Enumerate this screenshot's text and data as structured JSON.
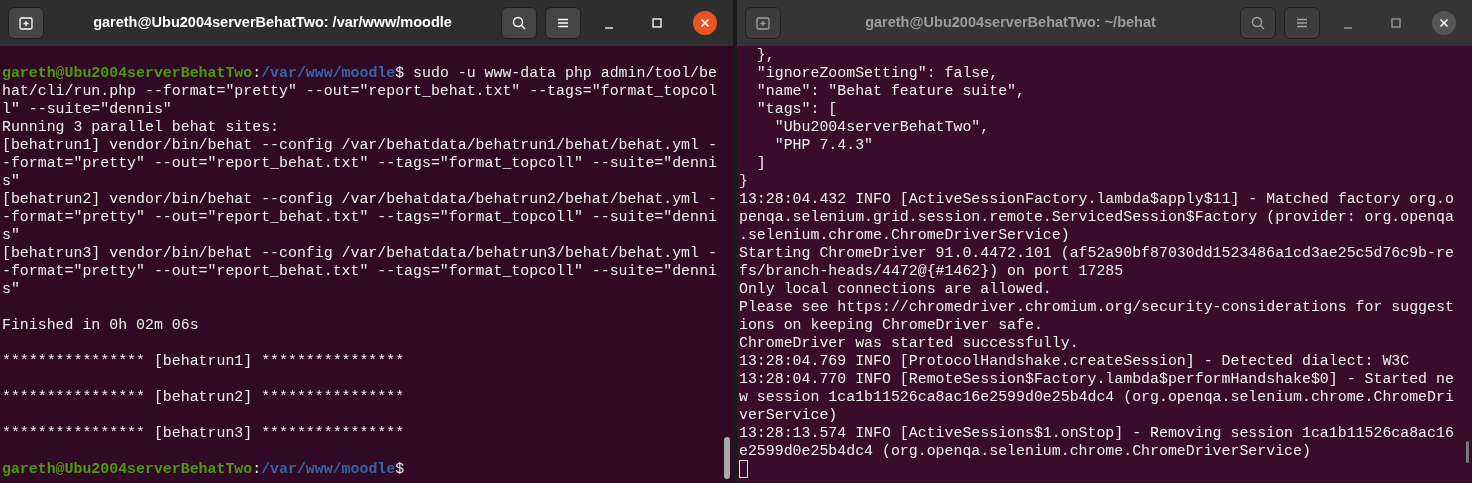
{
  "windows": [
    {
      "title": "gareth@Ubu2004serverBehatTwo: /var/www/moodle",
      "focused": true,
      "lines": [
        {
          "kind": "blank"
        },
        {
          "kind": "prompt",
          "segments": [
            {
              "kind": "user",
              "text": "gareth@Ubu2004serverBehatTwo"
            },
            {
              "kind": "plain",
              "text": ":"
            },
            {
              "kind": "path",
              "text": "/var/www/moodle"
            },
            {
              "kind": "plain",
              "text": "$ sudo -u www-data php admin/tool/be"
            }
          ]
        },
        {
          "kind": "text",
          "text": "hat/cli/run.php --format=\"pretty\" --out=\"report_behat.txt\" --tags=\"format_topcol"
        },
        {
          "kind": "text",
          "text": "l\" --suite=\"dennis\""
        },
        {
          "kind": "text",
          "text": "Running 3 parallel behat sites:"
        },
        {
          "kind": "text",
          "text": "[behatrun1] vendor/bin/behat --config /var/behatdata/behatrun1/behat/behat.yml -"
        },
        {
          "kind": "text",
          "text": "-format=\"pretty\" --out=\"report_behat.txt\" --tags=\"format_topcoll\" --suite=\"denni"
        },
        {
          "kind": "text",
          "text": "s\""
        },
        {
          "kind": "text",
          "text": "[behatrun2] vendor/bin/behat --config /var/behatdata/behatrun2/behat/behat.yml -"
        },
        {
          "kind": "text",
          "text": "-format=\"pretty\" --out=\"report_behat.txt\" --tags=\"format_topcoll\" --suite=\"denni"
        },
        {
          "kind": "text",
          "text": "s\""
        },
        {
          "kind": "text",
          "text": "[behatrun3] vendor/bin/behat --config /var/behatdata/behatrun3/behat/behat.yml -"
        },
        {
          "kind": "text",
          "text": "-format=\"pretty\" --out=\"report_behat.txt\" --tags=\"format_topcoll\" --suite=\"denni"
        },
        {
          "kind": "text",
          "text": "s\""
        },
        {
          "kind": "blank"
        },
        {
          "kind": "text",
          "text": "Finished in 0h 02m 06s"
        },
        {
          "kind": "blank"
        },
        {
          "kind": "text",
          "text": "**************** [behatrun1] ****************"
        },
        {
          "kind": "blank"
        },
        {
          "kind": "text",
          "text": "**************** [behatrun2] ****************"
        },
        {
          "kind": "blank"
        },
        {
          "kind": "text",
          "text": "**************** [behatrun3] ****************"
        },
        {
          "kind": "blank"
        },
        {
          "kind": "prompt",
          "segments": [
            {
              "kind": "user",
              "text": "gareth@Ubu2004serverBehatTwo"
            },
            {
              "kind": "plain",
              "text": ":"
            },
            {
              "kind": "path",
              "text": "/var/www/moodle"
            },
            {
              "kind": "plain",
              "text": "$"
            }
          ]
        }
      ]
    },
    {
      "title": "gareth@Ubu2004serverBehatTwo: ~/behat",
      "focused": false,
      "lines": [
        {
          "kind": "text",
          "text": "  },"
        },
        {
          "kind": "text",
          "text": "  \"ignoreZoomSetting\": false,"
        },
        {
          "kind": "text",
          "text": "  \"name\": \"Behat feature suite\","
        },
        {
          "kind": "text",
          "text": "  \"tags\": ["
        },
        {
          "kind": "text",
          "text": "    \"Ubu2004serverBehatTwo\","
        },
        {
          "kind": "text",
          "text": "    \"PHP 7.4.3\""
        },
        {
          "kind": "text",
          "text": "  ]"
        },
        {
          "kind": "text",
          "text": "}"
        },
        {
          "kind": "text",
          "text": "13:28:04.432 INFO [ActiveSessionFactory.lambda$apply$11] - Matched factory org.o"
        },
        {
          "kind": "text",
          "text": "penqa.selenium.grid.session.remote.ServicedSession$Factory (provider: org.openqa"
        },
        {
          "kind": "text",
          "text": ".selenium.chrome.ChromeDriverService)"
        },
        {
          "kind": "text",
          "text": "Starting ChromeDriver 91.0.4472.101 (af52a90bf87030dd1523486a1cd3ae25c5d76c9b-re"
        },
        {
          "kind": "text",
          "text": "fs/branch-heads/4472@{#1462}) on port 17285"
        },
        {
          "kind": "text",
          "text": "Only local connections are allowed."
        },
        {
          "kind": "text",
          "text": "Please see https://chromedriver.chromium.org/security-considerations for suggest"
        },
        {
          "kind": "text",
          "text": "ions on keeping ChromeDriver safe."
        },
        {
          "kind": "text",
          "text": "ChromeDriver was started successfully."
        },
        {
          "kind": "text",
          "text": "13:28:04.769 INFO [ProtocolHandshake.createSession] - Detected dialect: W3C"
        },
        {
          "kind": "text",
          "text": "13:28:04.770 INFO [RemoteSession$Factory.lambda$performHandshake$0] - Started ne"
        },
        {
          "kind": "text",
          "text": "w session 1ca1b11526ca8ac16e2599d0e25b4dc4 (org.openqa.selenium.chrome.ChromeDri"
        },
        {
          "kind": "text",
          "text": "verService)"
        },
        {
          "kind": "text",
          "text": "13:28:13.574 INFO [ActiveSessions$1.onStop] - Removing session 1ca1b11526ca8ac16"
        },
        {
          "kind": "text",
          "text": "e2599d0e25b4dc4 (org.openqa.selenium.chrome.ChromeDriverService)"
        },
        {
          "kind": "cursor"
        }
      ]
    }
  ]
}
